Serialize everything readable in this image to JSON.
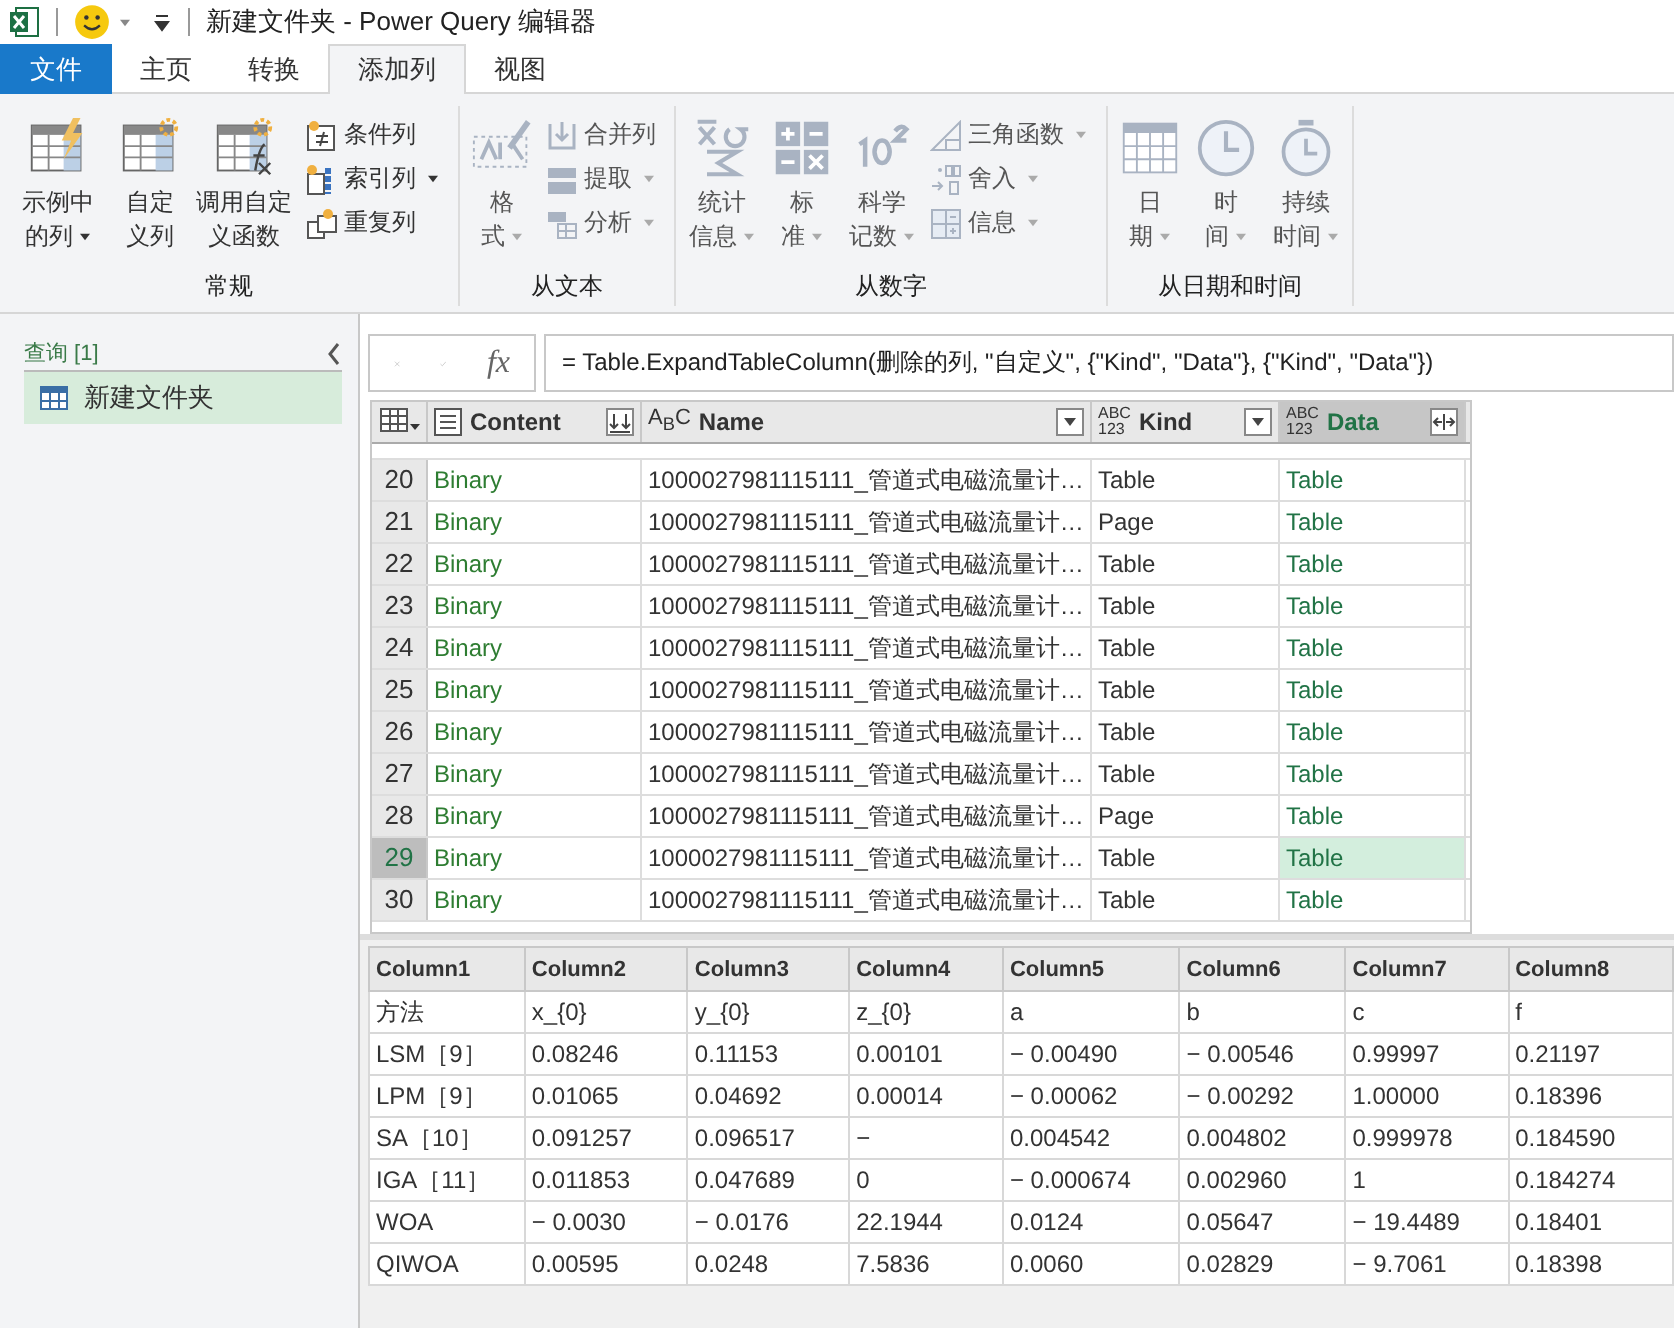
{
  "window": {
    "title": "新建文件夹 - Power Query 编辑器"
  },
  "tabs": [
    {
      "label": "文件",
      "kind": "file",
      "selected": false
    },
    {
      "label": "主页",
      "kind": "tab",
      "selected": false
    },
    {
      "label": "转换",
      "kind": "tab",
      "selected": false
    },
    {
      "label": "添加列",
      "kind": "tab",
      "selected": true
    },
    {
      "label": "视图",
      "kind": "tab",
      "selected": false
    }
  ],
  "ribbon_groups": [
    {
      "title": "常规",
      "items": [
        {
          "kind": "large",
          "label": "示例中的列",
          "dropdown": true,
          "disabled": false
        },
        {
          "kind": "large",
          "label": "自定义列",
          "dropdown": false,
          "disabled": false
        },
        {
          "kind": "large",
          "label": "调用自定义函数",
          "dropdown": false,
          "disabled": false
        },
        {
          "kind": "small",
          "label": "条件列",
          "dropdown": false,
          "disabled": false
        },
        {
          "kind": "small",
          "label": "索引列",
          "dropdown": true,
          "disabled": false
        },
        {
          "kind": "small",
          "label": "重复列",
          "dropdown": false,
          "disabled": false
        }
      ]
    },
    {
      "title": "从文本",
      "items": [
        {
          "kind": "large",
          "label": "格式",
          "dropdown": true,
          "disabled": true
        },
        {
          "kind": "small",
          "label": "合并列",
          "dropdown": false,
          "disabled": true
        },
        {
          "kind": "small",
          "label": "提取",
          "dropdown": true,
          "disabled": true
        },
        {
          "kind": "small",
          "label": "分析",
          "dropdown": true,
          "disabled": true
        }
      ]
    },
    {
      "title": "从数字",
      "items": [
        {
          "kind": "large",
          "label": "统计信息",
          "dropdown": true,
          "disabled": true
        },
        {
          "kind": "large",
          "label": "标准",
          "dropdown": true,
          "disabled": true
        },
        {
          "kind": "large",
          "label": "科学记数",
          "dropdown": true,
          "disabled": true
        },
        {
          "kind": "small",
          "label": "三角函数",
          "dropdown": true,
          "disabled": true
        },
        {
          "kind": "small",
          "label": "舍入",
          "dropdown": true,
          "disabled": true
        },
        {
          "kind": "small",
          "label": "信息",
          "dropdown": true,
          "disabled": true
        }
      ]
    },
    {
      "title": "从日期和时间",
      "items": [
        {
          "kind": "large",
          "label": "日期",
          "dropdown": true,
          "disabled": true
        },
        {
          "kind": "large",
          "label": "时间",
          "dropdown": true,
          "disabled": true
        },
        {
          "kind": "large",
          "label": "持续时间",
          "dropdown": true,
          "disabled": true
        }
      ]
    }
  ],
  "queries": {
    "header": "查询 [1]",
    "items": [
      {
        "label": "新建文件夹",
        "selected": true
      }
    ]
  },
  "formula_bar": {
    "fx_label": "fx",
    "formula": "= Table.ExpandTableColumn(删除的列, \"自定义\", {\"Kind\", \"Data\"}, {\"Kind\", \"Data\"})"
  },
  "table": {
    "columns": [
      {
        "name": "Content",
        "kind": "list",
        "button": {
          "kind": "combine"
        },
        "selected": false
      },
      {
        "name": "Name",
        "kind": "text",
        "type_badge": [
          "A$_{B}$C"
        ],
        "button": {
          "kind": "filter"
        },
        "selected": false
      },
      {
        "name": "Kind",
        "kind": "any",
        "type_badge": [
          "ABC",
          "123"
        ],
        "button": {
          "kind": "filter"
        },
        "selected": false
      },
      {
        "name": "Data",
        "kind": "any",
        "type_badge": [
          "ABC",
          "123"
        ],
        "button": {
          "kind": "expand"
        },
        "selected": true
      }
    ],
    "rows": [
      {
        "index": "20",
        "cells": [
          "Binary",
          "1000027981115111_管道式电磁流量计…",
          "Table",
          "Table"
        ],
        "selected": false
      },
      {
        "index": "21",
        "cells": [
          "Binary",
          "1000027981115111_管道式电磁流量计…",
          "Page",
          "Table"
        ],
        "selected": false
      },
      {
        "index": "22",
        "cells": [
          "Binary",
          "1000027981115111_管道式电磁流量计…",
          "Table",
          "Table"
        ],
        "selected": false
      },
      {
        "index": "23",
        "cells": [
          "Binary",
          "1000027981115111_管道式电磁流量计…",
          "Table",
          "Table"
        ],
        "selected": false
      },
      {
        "index": "24",
        "cells": [
          "Binary",
          "1000027981115111_管道式电磁流量计…",
          "Table",
          "Table"
        ],
        "selected": false
      },
      {
        "index": "25",
        "cells": [
          "Binary",
          "1000027981115111_管道式电磁流量计…",
          "Table",
          "Table"
        ],
        "selected": false
      },
      {
        "index": "26",
        "cells": [
          "Binary",
          "1000027981115111_管道式电磁流量计…",
          "Table",
          "Table"
        ],
        "selected": false
      },
      {
        "index": "27",
        "cells": [
          "Binary",
          "1000027981115111_管道式电磁流量计…",
          "Table",
          "Table"
        ],
        "selected": false
      },
      {
        "index": "28",
        "cells": [
          "Binary",
          "1000027981115111_管道式电磁流量计…",
          "Page",
          "Table"
        ],
        "selected": false
      },
      {
        "index": "29",
        "cells": [
          "Binary",
          "1000027981115111_管道式电磁流量计…",
          "Table",
          "Table"
        ],
        "selected": true
      },
      {
        "index": "30",
        "cells": [
          "Binary",
          "1000027981115111_管道式电磁流量计…",
          "Table",
          "Table"
        ],
        "selected": false
      }
    ]
  },
  "preview": {
    "columns": [
      "Column1",
      "Column2",
      "Column3",
      "Column4",
      "Column5",
      "Column6",
      "Column7",
      "Column8"
    ],
    "rows": [
      [
        "方法",
        "x_{0}",
        "y_{0}",
        "z_{0}",
        "a",
        "b",
        "c",
        "f"
      ],
      [
        "LSM［9］",
        "0.08246",
        "0.11153",
        "0.00101",
        "− 0.00490",
        "− 0.00546",
        "0.99997",
        "0.21197"
      ],
      [
        "LPM［9］",
        "0.01065",
        "0.04692",
        "0.00014",
        "− 0.00062",
        "− 0.00292",
        "1.00000",
        "0.18396"
      ],
      [
        "SA［10］",
        "0.091257",
        "0.096517",
        "−",
        "0.004542",
        "0.004802",
        "0.999978",
        "0.184590"
      ],
      [
        "IGA［11］",
        "0.011853",
        "0.047689",
        "0",
        "− 0.000674",
        "0.002960",
        "1",
        "0.184274"
      ],
      [
        "WOA",
        "− 0.0030",
        "− 0.0176",
        "22.1944",
        "0.0124",
        "0.05647",
        "− 19.4489",
        "0.18401"
      ],
      [
        "QIWOA",
        "0.00595",
        "0.0248",
        "7.5836",
        "0.0060",
        "0.02829",
        "− 9.7061",
        "0.18398"
      ]
    ]
  }
}
